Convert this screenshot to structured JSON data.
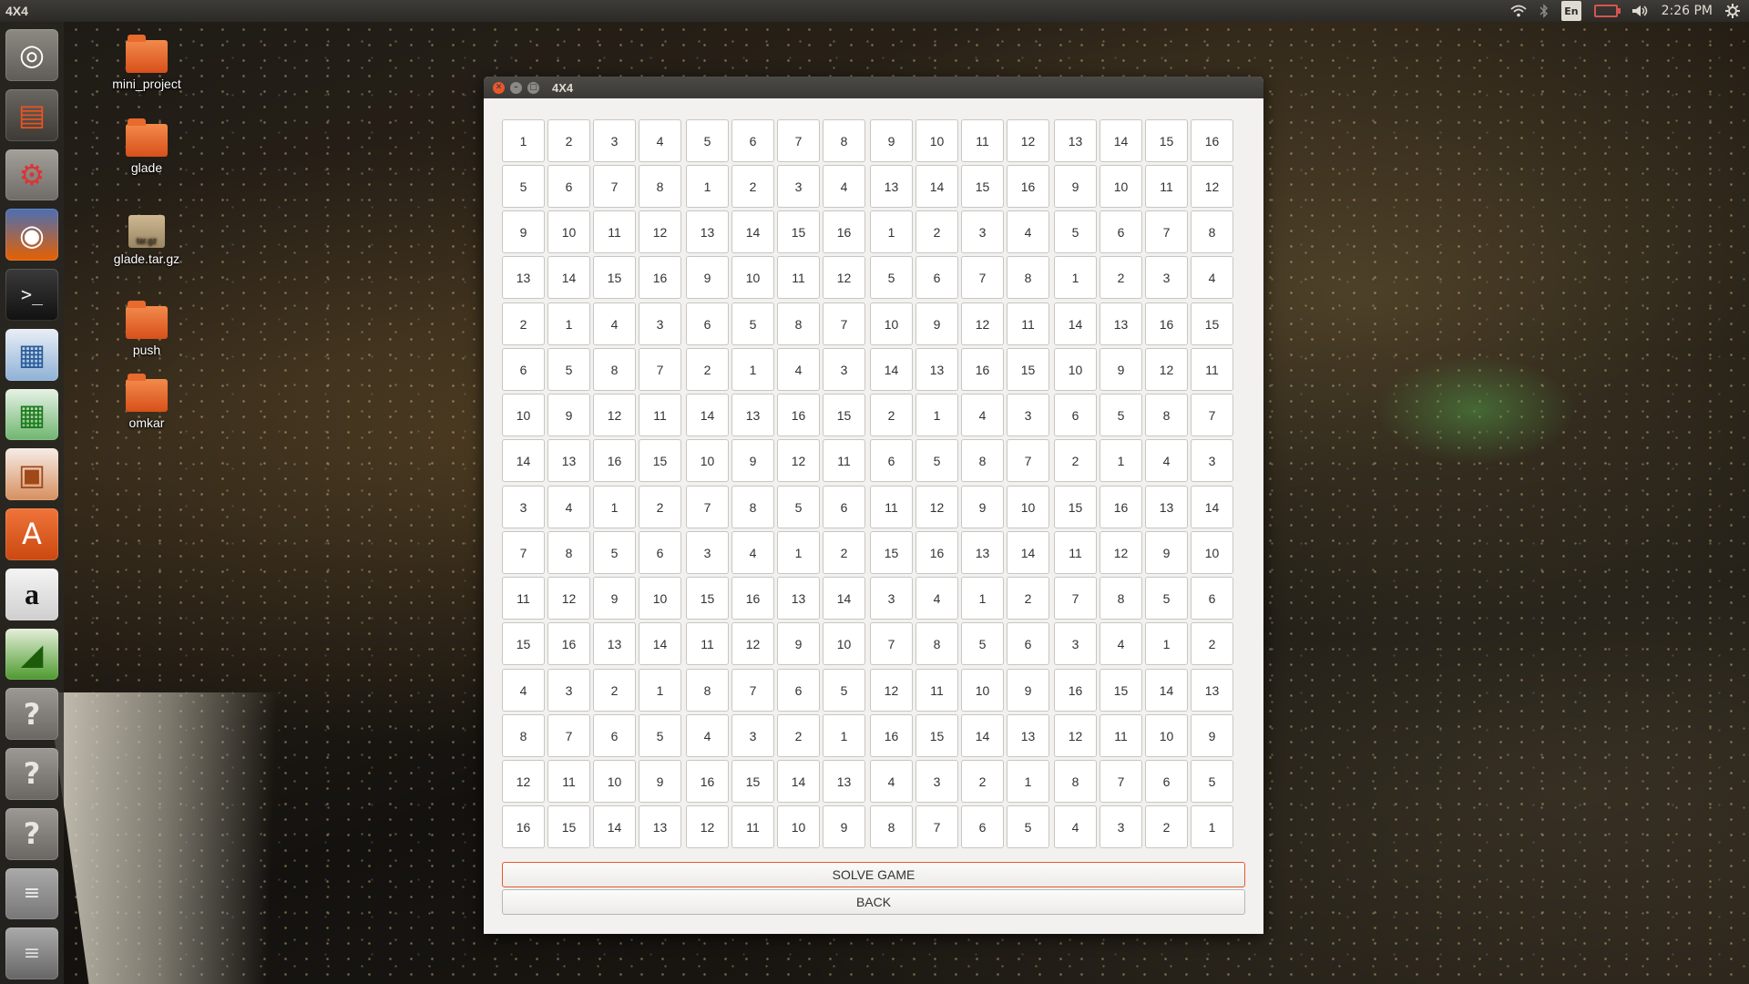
{
  "panel": {
    "app_title": "4X4",
    "keyboard": "En",
    "time": "2:26 PM",
    "icons": [
      "wifi-icon",
      "keyboard-layout-icon",
      "bluetooth-icon",
      "battery-icon",
      "volume-icon",
      "power-settings-icon"
    ]
  },
  "launcher": {
    "items": [
      {
        "name": "ubuntu-home",
        "glyph": "◎"
      },
      {
        "name": "files",
        "glyph": "▤"
      },
      {
        "name": "system-settings",
        "glyph": "⚙"
      },
      {
        "name": "firefox",
        "glyph": "◉"
      },
      {
        "name": "terminal",
        "glyph": ">_"
      },
      {
        "name": "libreoffice-writer",
        "glyph": "▦"
      },
      {
        "name": "libreoffice-calc",
        "glyph": "▦"
      },
      {
        "name": "libreoffice-impress",
        "glyph": "▣"
      },
      {
        "name": "software-center",
        "glyph": "A"
      },
      {
        "name": "amazon",
        "glyph": "a"
      },
      {
        "name": "libreoffice-draw",
        "glyph": "◢"
      },
      {
        "name": "unknown-app-1",
        "glyph": "?"
      },
      {
        "name": "unknown-app-2",
        "glyph": "?"
      },
      {
        "name": "unknown-app-3",
        "glyph": "?"
      },
      {
        "name": "workspace-switcher",
        "glyph": "≡"
      },
      {
        "name": "trash",
        "glyph": "≡"
      }
    ]
  },
  "desktop": {
    "icons": [
      {
        "label": "mini_project",
        "type": "folder"
      },
      {
        "label": "glade",
        "type": "folder"
      },
      {
        "label": "glade.tar.gz",
        "type": "archive",
        "badge": "tar.gz"
      },
      {
        "label": "push",
        "type": "folder"
      },
      {
        "label": "omkar",
        "type": "folder"
      }
    ]
  },
  "window": {
    "title": "4X4",
    "grid": [
      [
        1,
        2,
        3,
        4,
        5,
        6,
        7,
        8,
        9,
        10,
        11,
        12,
        13,
        14,
        15,
        16
      ],
      [
        5,
        6,
        7,
        8,
        1,
        2,
        3,
        4,
        13,
        14,
        15,
        16,
        9,
        10,
        11,
        12
      ],
      [
        9,
        10,
        11,
        12,
        13,
        14,
        15,
        16,
        1,
        2,
        3,
        4,
        5,
        6,
        7,
        8
      ],
      [
        13,
        14,
        15,
        16,
        9,
        10,
        11,
        12,
        5,
        6,
        7,
        8,
        1,
        2,
        3,
        4
      ],
      [
        2,
        1,
        4,
        3,
        6,
        5,
        8,
        7,
        10,
        9,
        12,
        11,
        14,
        13,
        16,
        15
      ],
      [
        6,
        5,
        8,
        7,
        2,
        1,
        4,
        3,
        14,
        13,
        16,
        15,
        10,
        9,
        12,
        11
      ],
      [
        10,
        9,
        12,
        11,
        14,
        13,
        16,
        15,
        2,
        1,
        4,
        3,
        6,
        5,
        8,
        7
      ],
      [
        14,
        13,
        16,
        15,
        10,
        9,
        12,
        11,
        6,
        5,
        8,
        7,
        2,
        1,
        4,
        3
      ],
      [
        3,
        4,
        1,
        2,
        7,
        8,
        5,
        6,
        11,
        12,
        9,
        10,
        15,
        16,
        13,
        14
      ],
      [
        7,
        8,
        5,
        6,
        3,
        4,
        1,
        2,
        15,
        16,
        13,
        14,
        11,
        12,
        9,
        10
      ],
      [
        11,
        12,
        9,
        10,
        15,
        16,
        13,
        14,
        3,
        4,
        1,
        2,
        7,
        8,
        5,
        6
      ],
      [
        15,
        16,
        13,
        14,
        11,
        12,
        9,
        10,
        7,
        8,
        5,
        6,
        3,
        4,
        1,
        2
      ],
      [
        4,
        3,
        2,
        1,
        8,
        7,
        6,
        5,
        12,
        11,
        10,
        9,
        16,
        15,
        14,
        13
      ],
      [
        8,
        7,
        6,
        5,
        4,
        3,
        2,
        1,
        16,
        15,
        14,
        13,
        12,
        11,
        10,
        9
      ],
      [
        12,
        11,
        10,
        9,
        16,
        15,
        14,
        13,
        4,
        3,
        2,
        1,
        8,
        7,
        6,
        5
      ],
      [
        16,
        15,
        14,
        13,
        12,
        11,
        10,
        9,
        8,
        7,
        6,
        5,
        4,
        3,
        2,
        1
      ]
    ],
    "solve_label": "SOLVE GAME",
    "back_label": "BACK"
  },
  "colors": {
    "accent": "#e9572c",
    "panel_bg": "#2b2a27",
    "window_bg": "#f2f1f0"
  }
}
